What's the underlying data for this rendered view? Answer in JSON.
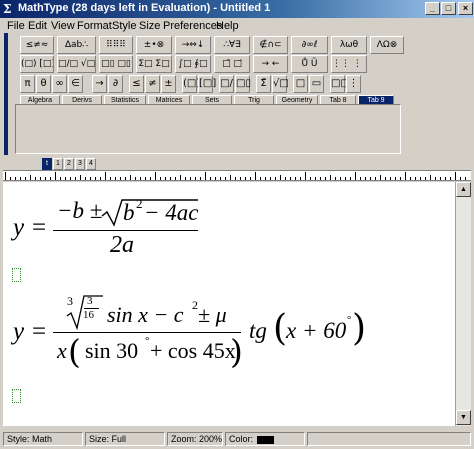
{
  "window": {
    "title": "MathType (28 days left in Evaluation) - Untitled 1",
    "min_glyph": "_",
    "max_glyph": "□",
    "close_glyph": "×",
    "app_icon": "Σ"
  },
  "menu": [
    "File",
    "Edit",
    "View",
    "Format",
    "Style",
    "Size",
    "Preferences",
    "Help"
  ],
  "symbol_groups": [
    "≤≠≈",
    "∆ab∴",
    "⠿⠿⠿",
    "±•⊗",
    "→⇔↓",
    "∴∀∃",
    "∉∩⊂",
    "∂∞ℓ",
    "λωθ",
    "ΛΩ⊗"
  ],
  "template_groups": [
    "(□) [□]",
    "□/□ √□",
    "□▯ □▯",
    "Σ□ Σ□",
    "∫□ ∮□",
    "□̄ □⃗",
    "→ ←",
    "Ů Ũ",
    "⋮⋮ ⋮⋮"
  ],
  "small_palette": [
    "π",
    "θ",
    "∞",
    "∈",
    "→",
    "∂",
    "≤",
    "≠",
    "±",
    "(□)",
    "[□]",
    "□/□",
    "□▯",
    "Σ̄",
    "√□",
    "□",
    "▭",
    "□□",
    "⋮"
  ],
  "tabs": [
    "Algebra",
    "Derivs",
    "Statistics",
    "Matrices",
    "Sets",
    "Trig",
    "Geometry",
    "Tab 8",
    "Tab 9"
  ],
  "active_tab": "Tab 9",
  "mini_toolbar": [
    "t",
    "1",
    "2",
    "3",
    "4"
  ],
  "scrollbar": {
    "up": "▲",
    "down": "▼"
  },
  "equation1": {
    "lhs": "y =",
    "num_prefix": "−b ±",
    "radicand_b": "b",
    "radicand_exp": "2",
    "radicand_rest": " − 4ac",
    "denominator": "2a"
  },
  "equation2": {
    "lhs": "y =",
    "root_index": "3",
    "inner_num": "3",
    "inner_den": "16",
    "after_root": "sin x − c",
    "c_exp": "2",
    "pm_mu": " ± μ",
    "den_x": "x",
    "den_sin": "sin 30",
    "deg": "°",
    "den_plus_cos": " + cos 45x",
    "tg": "tg",
    "arg": "x + 60"
  },
  "status": {
    "style": "Style: Math",
    "size": "Size: Full",
    "zoom": "Zoom: 200%",
    "color_label": "Color:",
    "color_value": "#000000"
  }
}
